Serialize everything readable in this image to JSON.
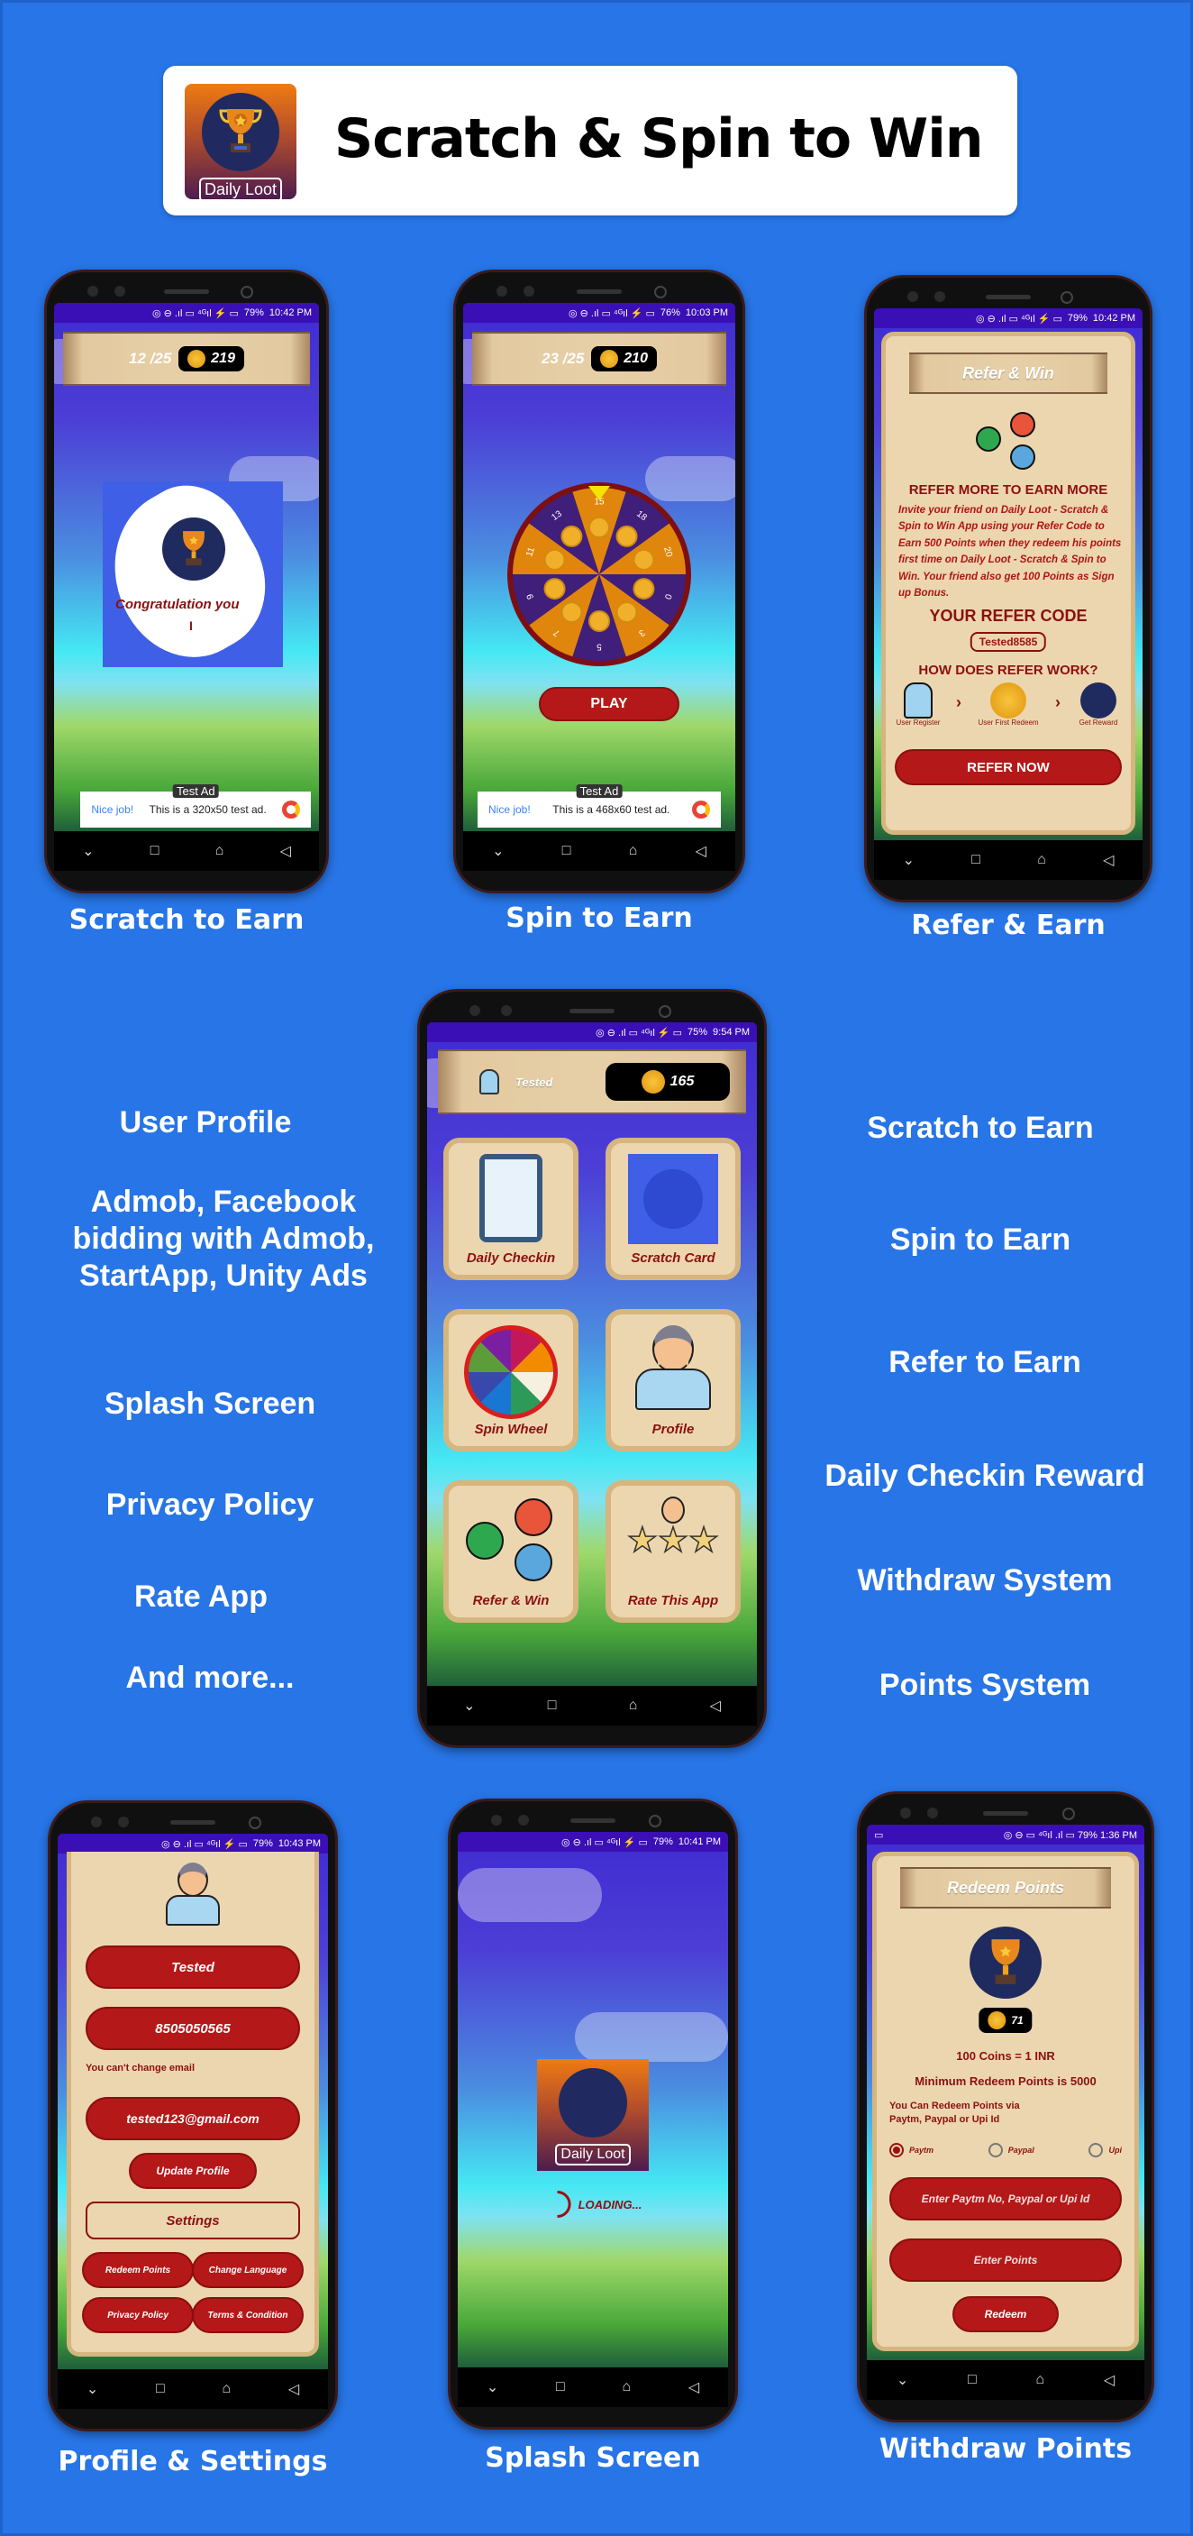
{
  "header": {
    "title": "Scratch & Spin to Win",
    "logo_label": "Daily Loot"
  },
  "captions": {
    "scratch": "Scratch to Earn",
    "spin": "Spin to Earn",
    "refer": "Refer & Earn",
    "profile": "Profile & Settings",
    "splash": "Splash Screen",
    "withdraw": "Withdraw Points"
  },
  "features_left": [
    "User Profile",
    "Admob, Facebook bidding with Admob, StartApp, Unity Ads",
    "Splash Screen",
    "Privacy Policy",
    "Rate App",
    "And more..."
  ],
  "features_right": [
    "Scratch to Earn",
    "Spin to Earn",
    "Refer to Earn",
    "Daily Checkin Reward",
    "Withdraw System",
    "Points System"
  ],
  "scratch_screen": {
    "status": {
      "battery": "79%",
      "time": "10:42 PM"
    },
    "progress": "12 /25",
    "coins": "219",
    "card_text": "Congratulation you",
    "card_subtext": "I",
    "ad": {
      "tag": "Test Ad",
      "headline": "Nice job!",
      "text": "This is a 320x50 test ad."
    }
  },
  "spin_screen": {
    "status": {
      "battery": "76%",
      "time": "10:03 PM"
    },
    "progress": "23 /25",
    "coins": "210",
    "wheel_values": [
      "15",
      "18",
      "20",
      "0",
      "3",
      "5",
      "7",
      "9",
      "11",
      "13"
    ],
    "play_label": "PLAY",
    "ad": {
      "tag": "Test Ad",
      "headline": "Nice job!",
      "text": "This is a 468x60 test ad."
    }
  },
  "refer_screen": {
    "status": {
      "battery": "79%",
      "time": "10:42 PM"
    },
    "title": "Refer & Win",
    "heading": "REFER MORE TO EARN MORE",
    "body": "Invite your friend on Daily Loot - Scratch & Spin to Win App using your Refer Code to Earn 500 Points when they redeem his points first time on Daily Loot - Scratch & Spin to Win. Your friend also get 100 Points as Sign up Bonus.",
    "code_label": "YOUR REFER CODE",
    "code": "Tested8585",
    "how_label": "HOW DOES REFER WORK?",
    "steps": [
      "User Register",
      "User First Redeem",
      "Get Reward"
    ],
    "button": "REFER NOW"
  },
  "home_screen": {
    "status": {
      "battery": "75%",
      "time": "9:54 PM"
    },
    "username": "Tested",
    "coins": "165",
    "tiles": [
      "Daily Checkin",
      "Scratch Card",
      "Spin Wheel",
      "Profile",
      "Refer & Win",
      "Rate This App"
    ]
  },
  "profile_screen": {
    "status": {
      "battery": "79%",
      "time": "10:43 PM"
    },
    "name": "Tested",
    "phone": "8505050565",
    "email_note": "You can't change email",
    "email": "tested123@gmail.com",
    "update_button": "Update Profile",
    "settings_label": "Settings",
    "buttons": [
      "Redeem Points",
      "Change Language",
      "Privacy Policy",
      "Terms & Condition"
    ]
  },
  "splash_screen": {
    "status": {
      "battery": "79%",
      "time": "10:41 PM"
    },
    "logo_label": "Daily Loot",
    "loading": "LOADING..."
  },
  "redeem_screen": {
    "status": {
      "battery": "79%",
      "time": "1:36 PM"
    },
    "title": "Redeem Points",
    "coins": "71",
    "rate": "100 Coins = 1 INR",
    "minimum": "Minimum Redeem Points is 5000",
    "info": "You Can Redeem Points via Paytm, Paypal or Upi Id",
    "methods": [
      "Paytm",
      "Paypal",
      "Upi"
    ],
    "selected_method": "Paytm",
    "id_placeholder": "Enter Paytm No, Paypal or Upi Id",
    "points_placeholder": "Enter Points",
    "redeem_button": "Redeem"
  },
  "colors": {
    "background": "#2775e6",
    "maroon": "#8c1010",
    "button_red": "#b51818",
    "beige": "#ecd6b0",
    "status_purple": "#3b0fb6"
  }
}
